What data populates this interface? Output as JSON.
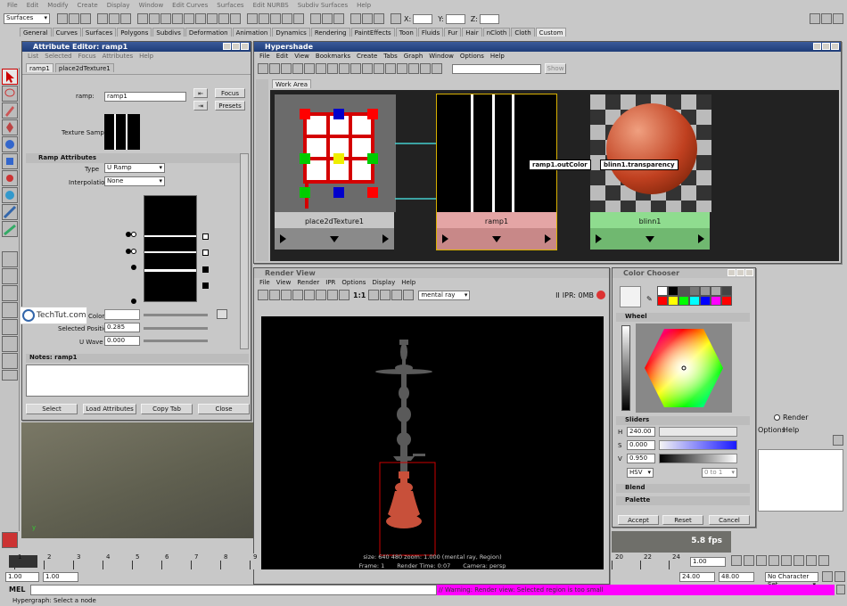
{
  "main_menu": [
    "File",
    "Edit",
    "Modify",
    "Create",
    "Display",
    "Window",
    "Edit Curves",
    "Surfaces",
    "Edit NURBS",
    "Subdiv Surfaces",
    "Help"
  ],
  "mode_select": "Surfaces",
  "coords": {
    "x_label": "X:",
    "y_label": "Y:",
    "z_label": "Z:"
  },
  "shelf_tabs": [
    "General",
    "Curves",
    "Surfaces",
    "Polygons",
    "Subdivs",
    "Deformation",
    "Animation",
    "Dynamics",
    "Rendering",
    "PaintEffects",
    "Toon",
    "Fluids",
    "Fur",
    "Hair",
    "nCloth",
    "Cloth",
    "Custom"
  ],
  "attr_editor": {
    "title": "Attribute Editor: ramp1",
    "menu": [
      "List",
      "Selected",
      "Focus",
      "Attributes",
      "Help"
    ],
    "tabs": [
      "ramp1",
      "place2dTexture1"
    ],
    "ramp_label": "ramp:",
    "ramp_value": "ramp1",
    "focus": "Focus",
    "presets": "Presets",
    "texture_sample": "Texture Sample",
    "section": "Ramp Attributes",
    "type_label": "Type",
    "type_value": "U Ramp",
    "interp_label": "Interpolation",
    "interp_value": "None",
    "color_label": "Color",
    "selpos_label": "Selected Position",
    "selpos_value": "0.285",
    "uwave_label": "U Wave",
    "uwave_value": "0.000",
    "notes_label": "Notes:  ramp1",
    "buttons": [
      "Select",
      "Load Attributes",
      "Copy Tab",
      "Close"
    ]
  },
  "watermark": "TechTut.com",
  "hypershade": {
    "title": "Hypershade",
    "menu": [
      "File",
      "Edit",
      "View",
      "Bookmarks",
      "Create",
      "Tabs",
      "Graph",
      "Window",
      "Options",
      "Help"
    ],
    "show_btn": "Show",
    "tab": "Work Area",
    "nodes": [
      {
        "name": "place2dTexture1",
        "color": "#c6c6c6"
      },
      {
        "name": "ramp1",
        "color": "#e4a5a5"
      },
      {
        "name": "blinn1",
        "color": "#8fdc8f"
      }
    ],
    "conn_src": "ramp1.outColor",
    "conn_dst": "blinn1.transparency"
  },
  "render_view": {
    "title": "Render View",
    "menu": [
      "File",
      "View",
      "Render",
      "IPR",
      "Options",
      "Display",
      "Help"
    ],
    "ratio": "1:1",
    "renderer": "mental ray",
    "ipr": "IPR: 0MB",
    "info1": "size:  640  480  zoom: 1.000        (mental ray, Region)",
    "frame": "Frame: 1",
    "render_time": "Render Time: 0:07",
    "camera": "Camera: persp"
  },
  "color_chooser": {
    "title": "Color Chooser",
    "wheel": "Wheel",
    "sliders": "Sliders",
    "h_label": "H",
    "h_value": "240.00",
    "s_label": "S",
    "s_value": "0.000",
    "v_label": "V",
    "v_value": "0.950",
    "mode": "HSV",
    "range": "0 to 1",
    "blend": "Blend",
    "palette": "Palette",
    "buttons": [
      "Accept",
      "Reset",
      "Cancel"
    ],
    "swatches": [
      "#ffffff",
      "#000000",
      "#555555",
      "#777777",
      "#999999",
      "#aaaaaa",
      "#444444",
      "#ff0000",
      "#ffff00",
      "#00ff00",
      "#00ffff",
      "#0000ff",
      "#ff00ff",
      "#ff0000"
    ]
  },
  "behind_panel": {
    "render_radio": "Render",
    "options": "Options",
    "help": "Help",
    "fps": "5.8 fps"
  },
  "timeline": {
    "ticks": [
      "1",
      "2",
      "3",
      "4",
      "5",
      "6",
      "7",
      "8",
      "9"
    ],
    "ticks_right": [
      "20",
      "22",
      "24"
    ],
    "current": "1.00",
    "start": "1.00",
    "start2": "1.00",
    "end": "24.00",
    "end2": "48.00",
    "charset": "No Character Set"
  },
  "mel_label": "MEL",
  "mel_warning": "// Warning: Render view: Selected region is too small",
  "status": "Hypergraph: Select a node"
}
